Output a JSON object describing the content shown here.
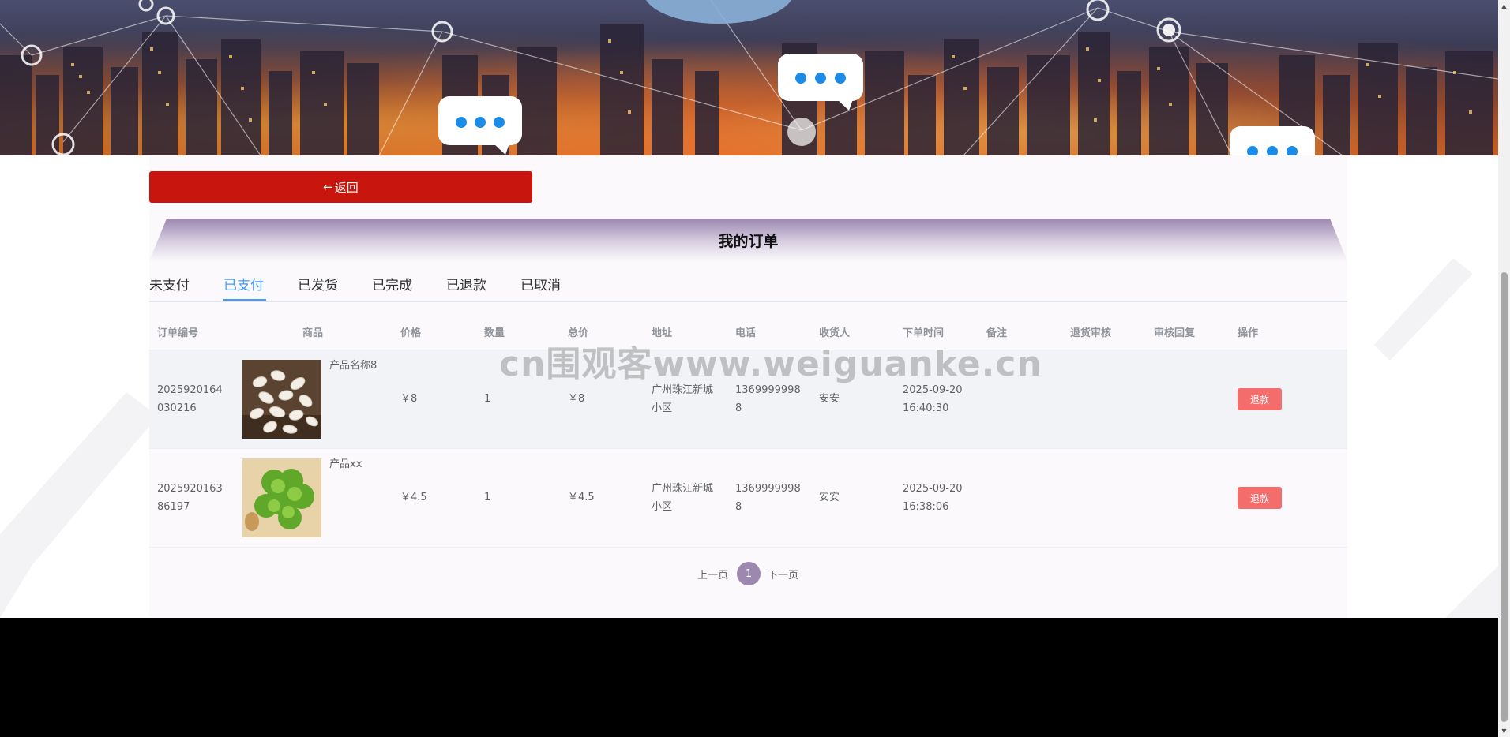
{
  "back_button": {
    "label": "返回",
    "icon": "arrow-left-icon"
  },
  "page_title": "我的订单",
  "tabs": [
    {
      "label": "未支付",
      "active": false
    },
    {
      "label": "已支付",
      "active": true
    },
    {
      "label": "已发货",
      "active": false
    },
    {
      "label": "已完成",
      "active": false
    },
    {
      "label": "已退款",
      "active": false
    },
    {
      "label": "已取消",
      "active": false
    }
  ],
  "table": {
    "headers": [
      "订单编号",
      "商品",
      "价格",
      "数量",
      "总价",
      "地址",
      "电话",
      "收货人",
      "下单时间",
      "备注",
      "退货审核",
      "审核回复",
      "操作"
    ],
    "rows": [
      {
        "order_no_line1": "2025920164",
        "order_no_line2": "030216",
        "product_name": "产品名称8",
        "product_image": "garlic-image",
        "price": "￥8",
        "quantity": "1",
        "total": "￥8",
        "address_line1": "广州珠江新城",
        "address_line2": "小区",
        "phone_line1": "1369999998",
        "phone_line2": "8",
        "receiver": "安安",
        "order_date": "2025-09-20",
        "order_time": "16:40:30",
        "remark": "",
        "return_review": "",
        "review_reply": "",
        "action": "退款"
      },
      {
        "order_no_line1": "2025920163",
        "order_no_line2": "86197",
        "product_name": "产品xx",
        "product_image": "lettuce-image",
        "price": "￥4.5",
        "quantity": "1",
        "total": "￥4.5",
        "address_line1": "广州珠江新城",
        "address_line2": "小区",
        "phone_line1": "1369999998",
        "phone_line2": "8",
        "receiver": "安安",
        "order_date": "2025-09-20",
        "order_time": "16:38:06",
        "remark": "",
        "return_review": "",
        "review_reply": "",
        "action": "退款"
      }
    ]
  },
  "pagination": {
    "prev": "上一页",
    "current": "1",
    "next": "下一页"
  },
  "watermark": "cn围观客www.weiguanke.cn",
  "colors": {
    "back_button": "#c8160f",
    "active_tab": "#409eff",
    "refund_button": "#f56c6c",
    "page_current": "#9d88b0",
    "title_band": "#9d88b0"
  }
}
